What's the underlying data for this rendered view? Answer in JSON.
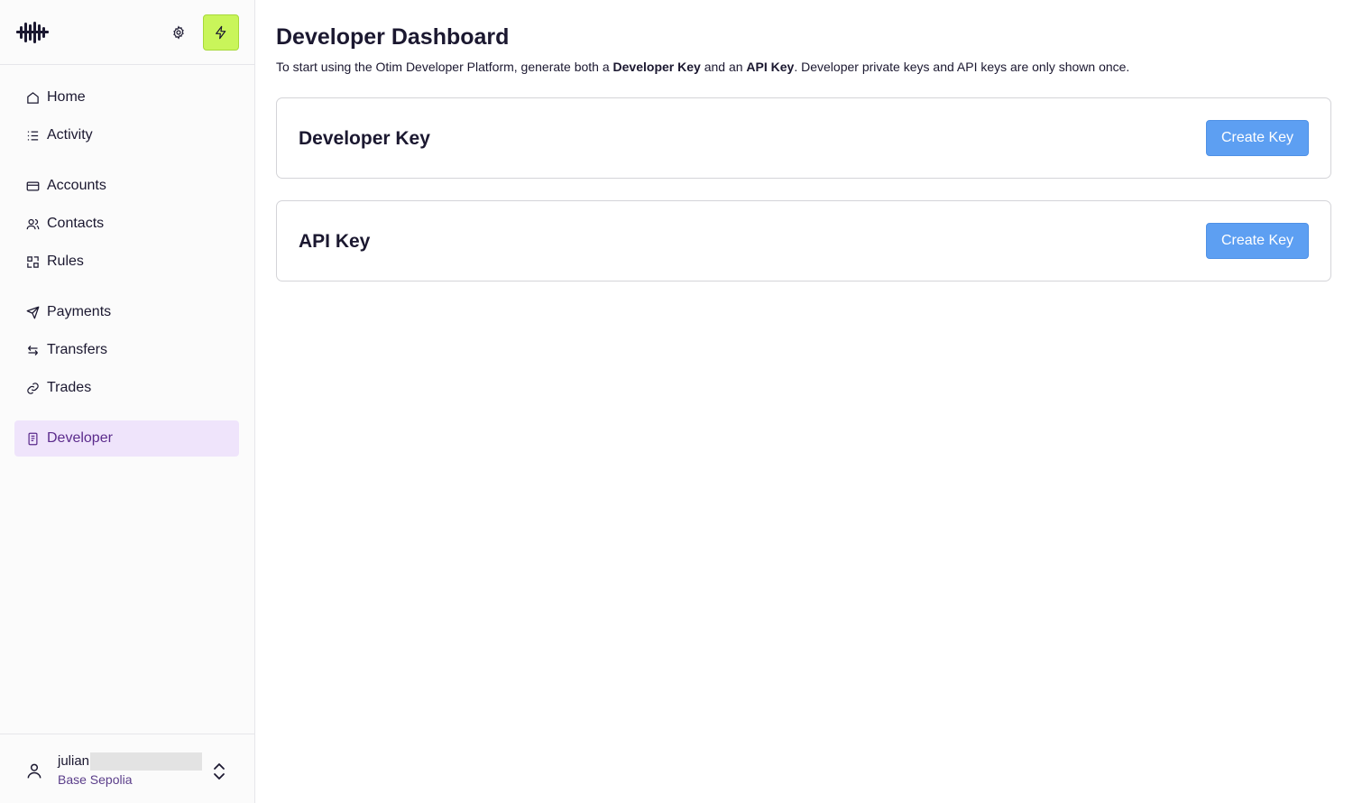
{
  "sidebar": {
    "logo": "otim-wave-logo",
    "settings_icon": "gear-icon",
    "quick_action_icon": "bolt-icon",
    "quick_action_color": "#c9f55a",
    "items": [
      {
        "label": "Home",
        "icon": "home-icon"
      },
      {
        "label": "Activity",
        "icon": "list-icon"
      },
      {
        "label": "Accounts",
        "icon": "wallet-icon"
      },
      {
        "label": "Contacts",
        "icon": "users-icon"
      },
      {
        "label": "Rules",
        "icon": "rules-icon"
      },
      {
        "label": "Payments",
        "icon": "send-icon"
      },
      {
        "label": "Transfers",
        "icon": "arrows-swap-icon"
      },
      {
        "label": "Trades",
        "icon": "link-icon"
      },
      {
        "label": "Developer",
        "icon": "document-icon",
        "active": true
      }
    ],
    "user": {
      "name": "julian",
      "network": "Base Sepolia"
    }
  },
  "main": {
    "title": "Developer Dashboard",
    "description": {
      "part1": "To start using the Otim Developer Platform, generate both a ",
      "bold1": "Developer Key",
      "part2": " and an ",
      "bold2": "API Key",
      "part3": ". Developer private keys and API keys are only shown once."
    },
    "cards": [
      {
        "title": "Developer Key",
        "button": "Create Key"
      },
      {
        "title": "API Key",
        "button": "Create Key"
      }
    ]
  },
  "colors": {
    "accent_button": "#5d9ff2",
    "active_nav_bg": "#efe4fb",
    "active_nav_text": "#5b2b8c"
  }
}
